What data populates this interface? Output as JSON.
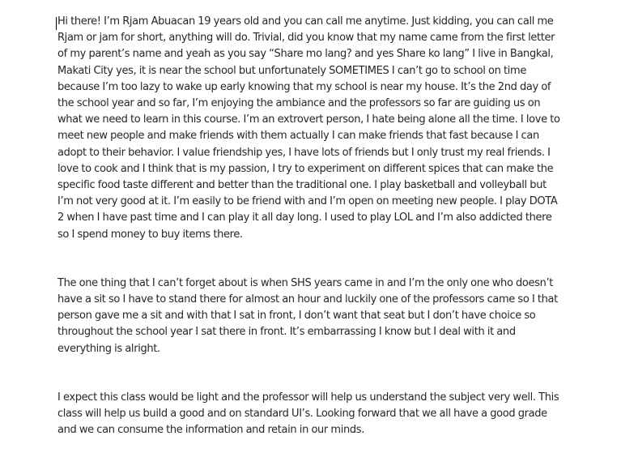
{
  "document": {
    "paragraphs": [
      "Hi there! I’m Rjam Abuacan 19 years old and you can call me anytime. Just kidding, you can call me Rjam or jam for short, anything will do. Trivial, did you know that my name came from the first letter of my parent’s name and yeah as you say “Share mo lang? and yes Share ko lang” I live in Bangkal, Makati City yes, it is near the school but unfortunately SOMETIMES I can’t go to school on time because I’m too lazy to wake up early knowing that my school is near my house. It’s the 2nd day of the school year and so far, I’m enjoying the ambiance and the professors so far are guiding us on what we need to learn in this course. I’m an extrovert person, I hate being alone all the time. I love to meet new people and make friends with them actually I can make friends that fast because I can adopt to their behavior. I value friendship yes, I have lots of friends but I only trust my real friends. I love to cook and I think that is my passion, I try to experiment on different spices that can make the specific food taste different and better than the traditional one. I play basketball and volleyball but I’m not very good at it.  I’m easily to be friend with and I’m open on meeting new people. I play DOTA 2 when I have past time and I can play it all day long. I used to play LOL and I’m also addicted there so I spend money to buy items there.",
      "The one thing that I can’t forget about is when SHS years came in and I’m the only one who doesn’t have a sit so I have to stand there for almost an hour and luckily one of the professors came so I that person gave me a sit and with that I sat in front, I don’t want that seat but I don’t have choice so throughout the school year I sat there in front. It’s embarrassing I know but I deal with it and everything is alright.",
      "I expect this class would be light and the professor will help us understand the subject very well. This class will help us build a good and on standard UI’s. Looking forward that we all have a good grade and we can consume the information and retain in our minds."
    ]
  }
}
